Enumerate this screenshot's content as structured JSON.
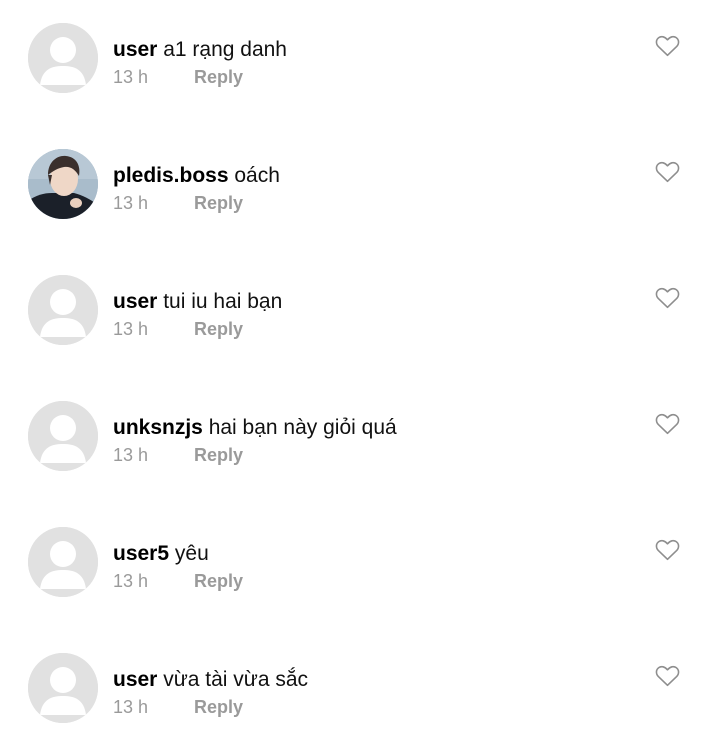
{
  "comments": [
    {
      "username": "user",
      "text": "a1 rạng danh",
      "time": "13 h",
      "reply_label": "Reply",
      "avatar": "default-avatar-icon"
    },
    {
      "username": "pledis.boss",
      "text": "oách",
      "time": "13 h",
      "reply_label": "Reply",
      "avatar": "profile-photo"
    },
    {
      "username": "user",
      "text": "tui iu hai bạn",
      "time": "13 h",
      "reply_label": "Reply",
      "avatar": "default-avatar-icon"
    },
    {
      "username": "unksnzjs",
      "text": "hai bạn này giỏi quá",
      "time": "13 h",
      "reply_label": "Reply",
      "avatar": "default-avatar-icon"
    },
    {
      "username": "user5",
      "text": "yêu",
      "time": "13 h",
      "reply_label": "Reply",
      "avatar": "default-avatar-icon"
    },
    {
      "username": "user",
      "text": "vừa tài vừa sắc",
      "time": "13 h",
      "reply_label": "Reply",
      "avatar": "default-avatar-icon"
    }
  ],
  "icons": {
    "like": "heart-outline-icon"
  },
  "colors": {
    "background": "#ffffff",
    "username": "#000000",
    "text": "#111111",
    "meta": "#9a9a9a",
    "avatar_placeholder": "#e1e1e1"
  }
}
